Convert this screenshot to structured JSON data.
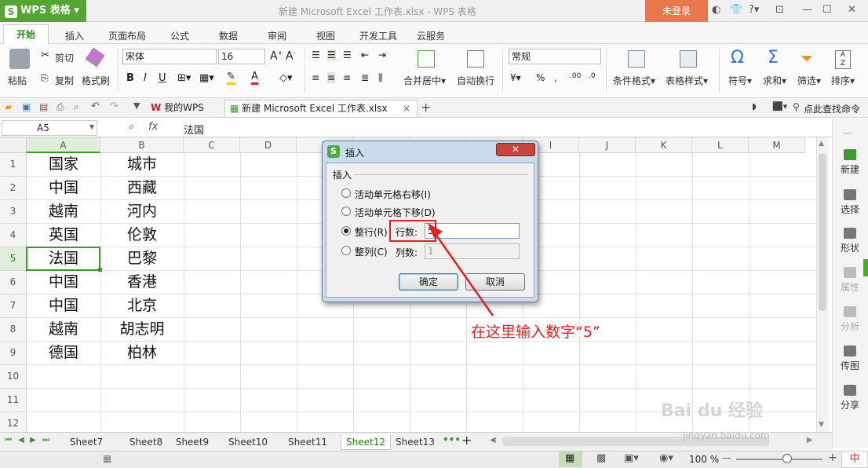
{
  "app": {
    "logo_text": "WPS 表格",
    "window_title": "新建 Microsoft Excel 工作表.xlsx - WPS 表格",
    "login": "未登录"
  },
  "menu": [
    "开始",
    "插入",
    "页面布局",
    "公式",
    "数据",
    "审阅",
    "视图",
    "开发工具",
    "云服务"
  ],
  "ribbon": {
    "paste": "粘贴",
    "cut": "剪切",
    "copy": "复制",
    "format_painter": "格式刷",
    "font_name": "宋体",
    "font_size": "16",
    "bold": "B",
    "italic": "I",
    "underline": "U",
    "merge_center": "合并居中",
    "wrap_text": "自动换行",
    "number_format": "常规",
    "conditional_format": "条件格式",
    "table_style": "表格样式",
    "symbol": "符号",
    "sum": "求和",
    "filter": "筛选",
    "sort": "排序"
  },
  "quickbar": {
    "mywps": "我的WPS",
    "doc_tab": "新建 Microsoft Excel 工作表.xlsx",
    "find_cmd": "点此查找命令"
  },
  "formula": {
    "name_box": "A5",
    "fx": "fx",
    "value": "法国"
  },
  "columns": [
    "A",
    "B",
    "C",
    "D",
    "E",
    "F",
    "G",
    "H",
    "I",
    "J",
    "K",
    "L",
    "M"
  ],
  "rows": [
    {
      "n": "1",
      "a": "国家",
      "b": "城市"
    },
    {
      "n": "2",
      "a": "中国",
      "b": "西藏"
    },
    {
      "n": "3",
      "a": "越南",
      "b": "河内"
    },
    {
      "n": "4",
      "a": "英国",
      "b": "伦敦"
    },
    {
      "n": "5",
      "a": "法国",
      "b": "巴黎"
    },
    {
      "n": "6",
      "a": "中国",
      "b": "香港"
    },
    {
      "n": "7",
      "a": "中国",
      "b": "北京"
    },
    {
      "n": "8",
      "a": "越南",
      "b": "胡志明"
    },
    {
      "n": "9",
      "a": "德国",
      "b": "柏林"
    },
    {
      "n": "10",
      "a": "",
      "b": ""
    },
    {
      "n": "11",
      "a": "",
      "b": ""
    },
    {
      "n": "12",
      "a": "",
      "b": ""
    }
  ],
  "side_panel": [
    "新建",
    "选择",
    "形状",
    "属性",
    "分析",
    "传图",
    "分享"
  ],
  "sheets": [
    "Sheet7",
    "Sheet8",
    "Sheet9",
    "Sheet10",
    "Sheet11",
    "Sheet12",
    "Sheet13"
  ],
  "active_sheet": "Sheet12",
  "status": {
    "zoom": "100 %",
    "ime": "中"
  },
  "dialog": {
    "title": "插入",
    "group": "插入",
    "opt1": "活动单元格右移(I)",
    "opt2": "活动单元格下移(D)",
    "opt3": "整行(R)",
    "opt4": "整列(C)",
    "rows_label": "行数:",
    "rows_value": "5",
    "cols_label": "列数:",
    "cols_value": "1",
    "ok": "确定",
    "cancel": "取消"
  },
  "annotation": "在这里输入数字“5”",
  "watermark": {
    "brand": "Bai du 经验",
    "url": "jingyan.baidu.com"
  },
  "colors": {
    "accent": "#55a532",
    "annotation": "#e82020",
    "selection": "#3a9a2a"
  }
}
